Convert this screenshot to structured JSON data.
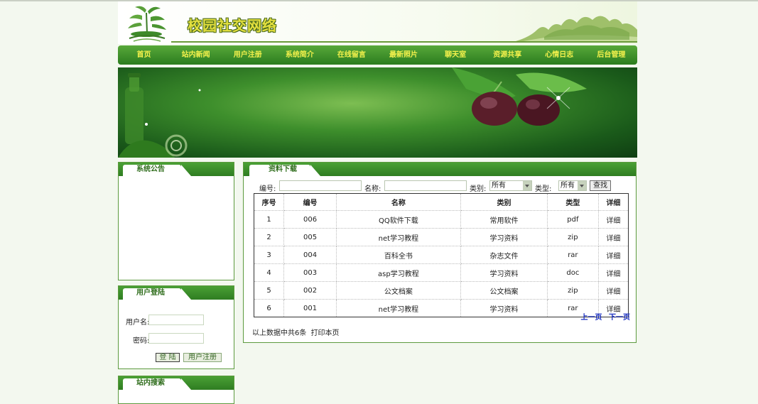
{
  "site": {
    "title": "校园社交网络"
  },
  "nav": {
    "items": [
      "首页",
      "站内新闻",
      "用户注册",
      "系统简介",
      "在线留言",
      "最新照片",
      "聊天室",
      "资源共享",
      "心情日志",
      "后台管理"
    ]
  },
  "sidebar": {
    "notice": {
      "title": "系统公告"
    },
    "login": {
      "title": "用户登陆",
      "username_label": "用户名:",
      "password_label": "密码:",
      "login_button": "登 陆",
      "register_button": "用户注册"
    },
    "search": {
      "title": "站内搜索"
    }
  },
  "main": {
    "title": "资料下载",
    "search": {
      "id_label": "编号:",
      "name_label": "名称:",
      "category_label": "类别:",
      "category_value": "所有",
      "type_label": "类型:",
      "type_value": "所有",
      "button": "查找"
    },
    "table": {
      "headers": [
        "序号",
        "编号",
        "名称",
        "类别",
        "类型",
        "详细"
      ],
      "rows": [
        [
          "1",
          "006",
          "QQ软件下载",
          "常用软件",
          "pdf",
          "详细"
        ],
        [
          "2",
          "005",
          "net学习教程",
          "学习资料",
          "zip",
          "详细"
        ],
        [
          "3",
          "004",
          "百科全书",
          "杂志文件",
          "rar",
          "详细"
        ],
        [
          "4",
          "003",
          "asp学习教程",
          "学习资料",
          "doc",
          "详细"
        ],
        [
          "5",
          "002",
          "公文档案",
          "公文档案",
          "zip",
          "详细"
        ],
        [
          "6",
          "001",
          "net学习教程",
          "学习资料",
          "rar",
          "详细"
        ]
      ]
    },
    "pager": {
      "prev": "上一页",
      "next": "下一页"
    },
    "summary": "以上数据中共6条",
    "print": "打印本页"
  },
  "colors": {
    "primary_green": "#2f7d22",
    "nav_text": "#f4f14c",
    "link_blue": "#1a2fc0"
  }
}
